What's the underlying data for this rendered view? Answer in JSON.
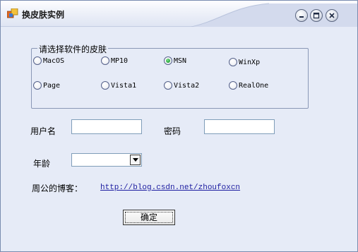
{
  "window": {
    "title": "换皮肤实例"
  },
  "skin_group": {
    "legend": "请选择软件的皮肤",
    "options": [
      {
        "label": "MacOS",
        "checked": false
      },
      {
        "label": "MP10",
        "checked": false
      },
      {
        "label": "MSN",
        "checked": true
      },
      {
        "label": "WinXp",
        "checked": false
      },
      {
        "label": "Page",
        "checked": false
      },
      {
        "label": "Vista1",
        "checked": false
      },
      {
        "label": "Vista2",
        "checked": false
      },
      {
        "label": "RealOne",
        "checked": false
      }
    ]
  },
  "form": {
    "username_label": "用户名",
    "username_value": "",
    "password_label": "密码",
    "password_value": "",
    "age_label": "年龄",
    "age_value": ""
  },
  "blog": {
    "label": "周公的博客：",
    "url": "http://blog.csdn.net/zhoufoxcn"
  },
  "ok_button": "确定",
  "colors": {
    "window_bg": "#e6ebf7",
    "selected_radio": "#24a33a",
    "link": "#1c1ca0"
  }
}
